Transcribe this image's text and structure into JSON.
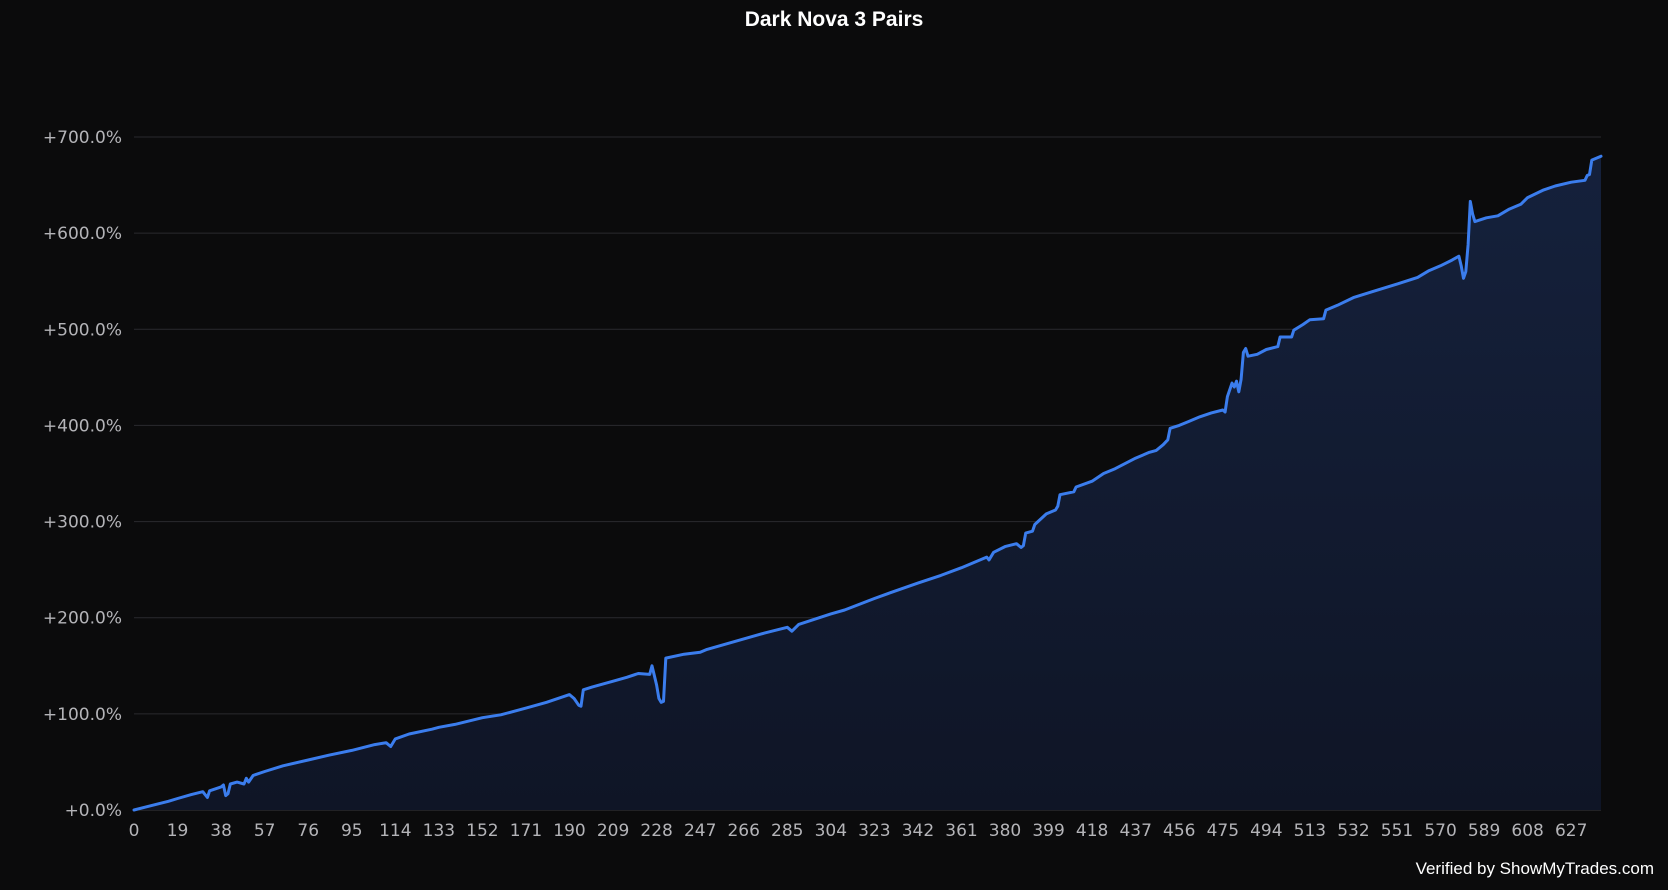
{
  "chart_data": {
    "type": "area",
    "title": "Dark Nova 3 Pairs",
    "xlabel": "",
    "ylabel": "",
    "x_range": [
      0,
      640
    ],
    "ylim": [
      0,
      700
    ],
    "grid": true,
    "legend": "none",
    "x_ticks": [
      "0",
      "19",
      "38",
      "57",
      "76",
      "95",
      "114",
      "133",
      "152",
      "171",
      "190",
      "209",
      "228",
      "247",
      "266",
      "285",
      "304",
      "323",
      "342",
      "361",
      "380",
      "399",
      "418",
      "437",
      "456",
      "475",
      "494",
      "513",
      "532",
      "551",
      "570",
      "589",
      "608",
      "627"
    ],
    "y_ticks": [
      "+0.0%",
      "+100.0%",
      "+200.0%",
      "+300.0%",
      "+400.0%",
      "+500.0%",
      "+600.0%",
      "+700.0%"
    ],
    "series": [
      {
        "points": [
          [
            0,
            0
          ],
          [
            5,
            3
          ],
          [
            10,
            6
          ],
          [
            15,
            9
          ],
          [
            19,
            12
          ],
          [
            25,
            16
          ],
          [
            30,
            19
          ],
          [
            32,
            13
          ],
          [
            33,
            20
          ],
          [
            38,
            24
          ],
          [
            39,
            26
          ],
          [
            40,
            15
          ],
          [
            41,
            17
          ],
          [
            42,
            27
          ],
          [
            45,
            29
          ],
          [
            48,
            27
          ],
          [
            49,
            33
          ],
          [
            50,
            29
          ],
          [
            52,
            36
          ],
          [
            57,
            40
          ],
          [
            65,
            46
          ],
          [
            76,
            52
          ],
          [
            85,
            57
          ],
          [
            95,
            62
          ],
          [
            105,
            68
          ],
          [
            110,
            70
          ],
          [
            112,
            66
          ],
          [
            114,
            74
          ],
          [
            120,
            79
          ],
          [
            130,
            84
          ],
          [
            133,
            86
          ],
          [
            140,
            89
          ],
          [
            152,
            96
          ],
          [
            160,
            99
          ],
          [
            171,
            106
          ],
          [
            180,
            112
          ],
          [
            190,
            120
          ],
          [
            192,
            116
          ],
          [
            194,
            109
          ],
          [
            195,
            108
          ],
          [
            196,
            125
          ],
          [
            200,
            128
          ],
          [
            209,
            134
          ],
          [
            215,
            138
          ],
          [
            220,
            142
          ],
          [
            225,
            141
          ],
          [
            226,
            150
          ],
          [
            227,
            140
          ],
          [
            228,
            130
          ],
          [
            229,
            116
          ],
          [
            230,
            112
          ],
          [
            231,
            113
          ],
          [
            232,
            158
          ],
          [
            240,
            162
          ],
          [
            247,
            164
          ],
          [
            250,
            167
          ],
          [
            266,
            178
          ],
          [
            275,
            184
          ],
          [
            285,
            190
          ],
          [
            287,
            186
          ],
          [
            290,
            193
          ],
          [
            304,
            204
          ],
          [
            310,
            208
          ],
          [
            323,
            220
          ],
          [
            330,
            226
          ],
          [
            342,
            236
          ],
          [
            352,
            244
          ],
          [
            361,
            252
          ],
          [
            372,
            263
          ],
          [
            373,
            260
          ],
          [
            375,
            268
          ],
          [
            380,
            274
          ],
          [
            385,
            277
          ],
          [
            387,
            273
          ],
          [
            388,
            275
          ],
          [
            389,
            288
          ],
          [
            392,
            290
          ],
          [
            393,
            297
          ],
          [
            398,
            308
          ],
          [
            402,
            312
          ],
          [
            403,
            316
          ],
          [
            404,
            328
          ],
          [
            410,
            331
          ],
          [
            411,
            336
          ],
          [
            418,
            342
          ],
          [
            423,
            350
          ],
          [
            428,
            355
          ],
          [
            437,
            366
          ],
          [
            443,
            372
          ],
          [
            446,
            374
          ],
          [
            449,
            380
          ],
          [
            451,
            385
          ],
          [
            452,
            397
          ],
          [
            456,
            400
          ],
          [
            460,
            404
          ],
          [
            465,
            409
          ],
          [
            470,
            413
          ],
          [
            475,
            416
          ],
          [
            476,
            414
          ],
          [
            477,
            430
          ],
          [
            479,
            444
          ],
          [
            480,
            440
          ],
          [
            481,
            446
          ],
          [
            482,
            435
          ],
          [
            483,
            448
          ],
          [
            484,
            476
          ],
          [
            485,
            480
          ],
          [
            486,
            472
          ],
          [
            490,
            474
          ],
          [
            494,
            479
          ],
          [
            499,
            482
          ],
          [
            500,
            492
          ],
          [
            505,
            492
          ],
          [
            506,
            499
          ],
          [
            510,
            505
          ],
          [
            513,
            510
          ],
          [
            519,
            511
          ],
          [
            520,
            520
          ],
          [
            525,
            525
          ],
          [
            532,
            533
          ],
          [
            540,
            539
          ],
          [
            551,
            547
          ],
          [
            560,
            554
          ],
          [
            565,
            561
          ],
          [
            570,
            566
          ],
          [
            575,
            572
          ],
          [
            578,
            576
          ],
          [
            579,
            566
          ],
          [
            580,
            553
          ],
          [
            581,
            560
          ],
          [
            582,
            588
          ],
          [
            583,
            633
          ],
          [
            584,
            620
          ],
          [
            585,
            612
          ],
          [
            590,
            616
          ],
          [
            595,
            618
          ],
          [
            600,
            625
          ],
          [
            605,
            630
          ],
          [
            608,
            637
          ],
          [
            615,
            645
          ],
          [
            620,
            649
          ],
          [
            627,
            653
          ],
          [
            633,
            655
          ],
          [
            634,
            660
          ],
          [
            635,
            661
          ],
          [
            636,
            676
          ],
          [
            640,
            680
          ]
        ],
        "color": "#3b7ded",
        "fill": "#152340"
      }
    ]
  },
  "watermark": "Verified by ShowMyTrades.com"
}
